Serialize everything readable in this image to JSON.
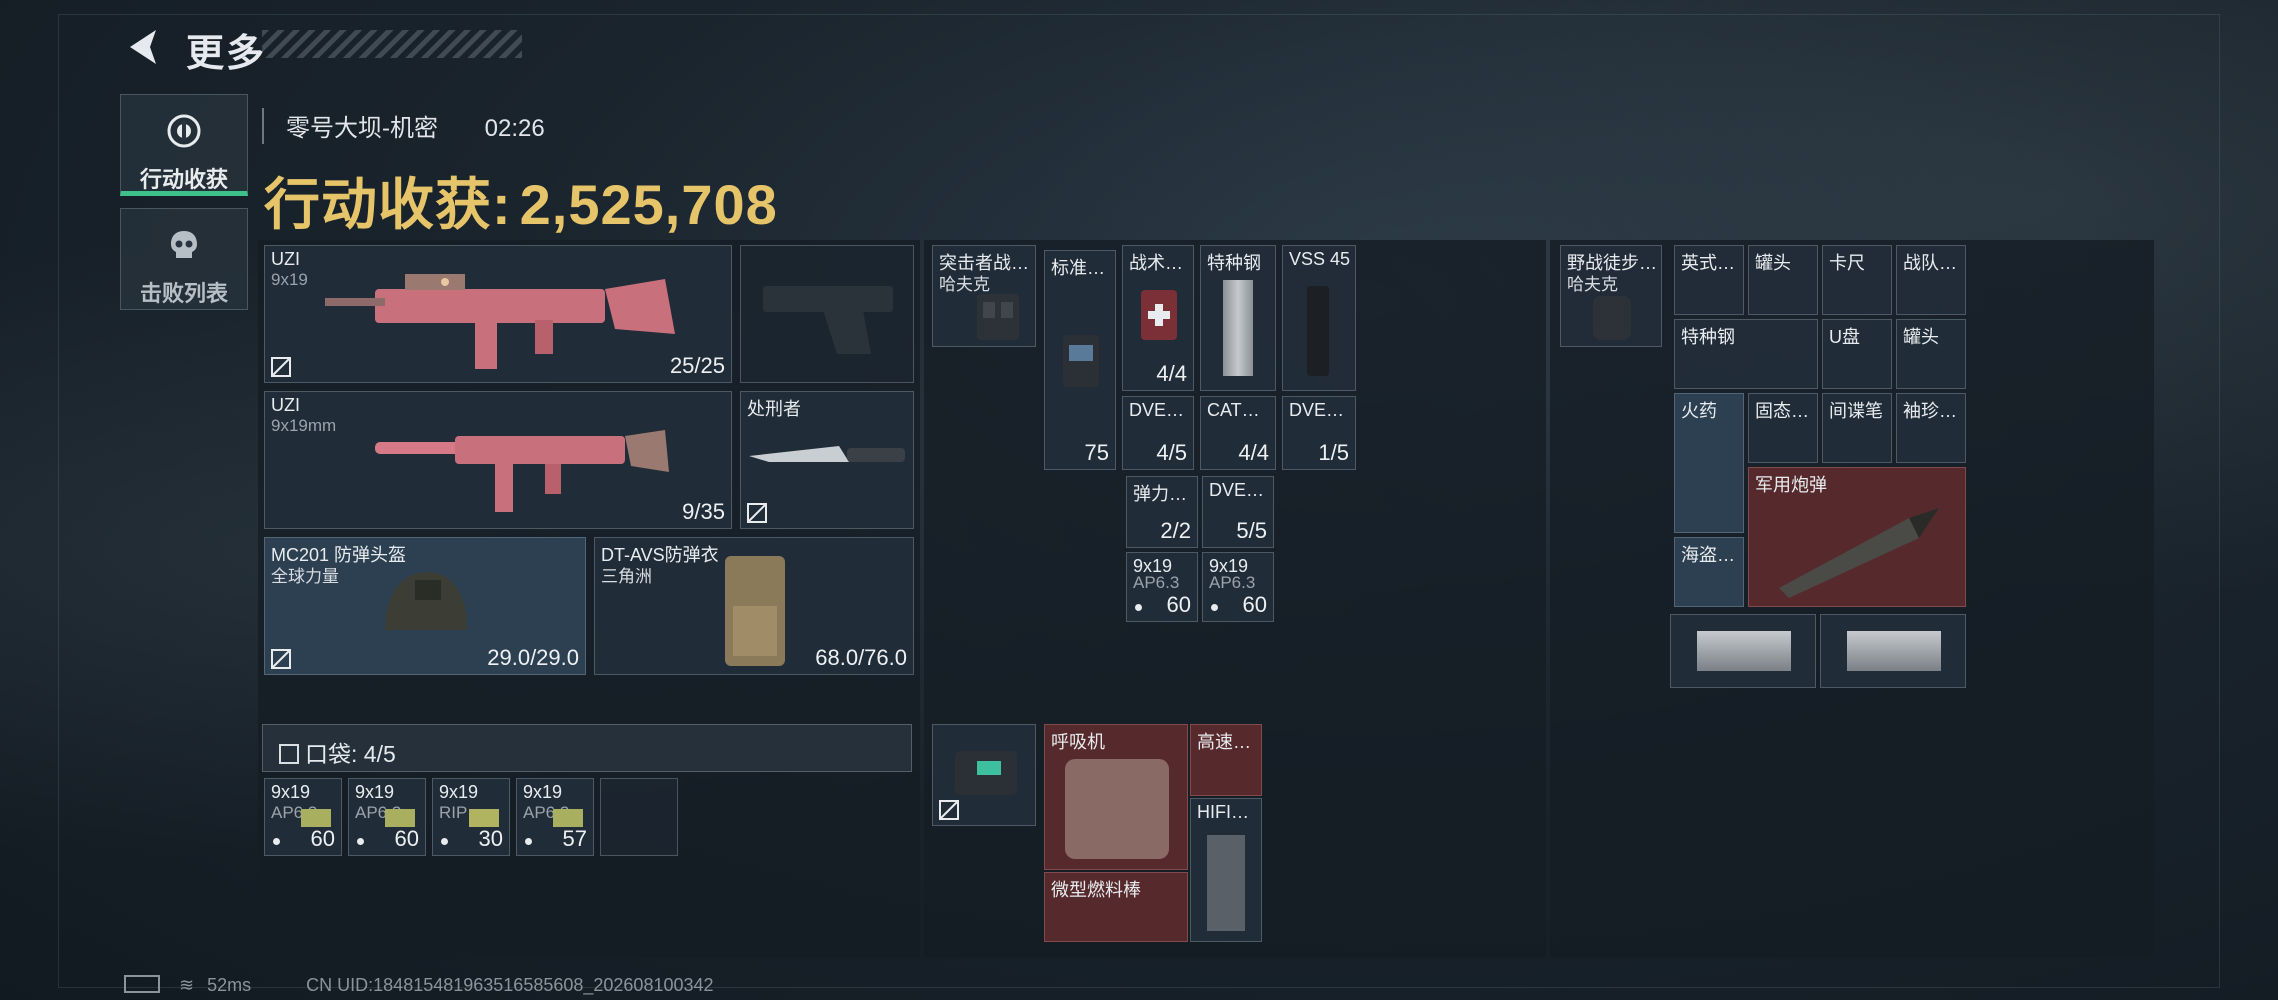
{
  "header": {
    "title": "更多"
  },
  "tabs": [
    {
      "label": "行动收获",
      "icon": "target-icon",
      "active": true
    },
    {
      "label": "击败列表",
      "icon": "skull-icon",
      "active": false
    }
  ],
  "map": {
    "name": "零号大坝-机密",
    "time": "02:26"
  },
  "gains": {
    "label": "行动收获:",
    "value": "2,525,708"
  },
  "weapons": [
    {
      "name": "UZI",
      "sub": "9x19",
      "count": "25/25"
    },
    {
      "name": "",
      "sub": "",
      "count": ""
    },
    {
      "name": "UZI",
      "sub": "9x19mm",
      "count": "9/35"
    },
    {
      "name": "处刑者",
      "sub": "",
      "count": ""
    }
  ],
  "armor": [
    {
      "name": "MC201 防弹头盔",
      "sub": "全球力量",
      "count": "29.0/29.0"
    },
    {
      "name": "DT-AVS防弹衣",
      "sub": "三角洲",
      "count": "68.0/76.0"
    }
  ],
  "pocket": {
    "label": "口袋:",
    "count": "4/5"
  },
  "pocket_items": [
    {
      "name": "9x19",
      "sub": "AP6.3",
      "count": "60"
    },
    {
      "name": "9x19",
      "sub": "AP6.3",
      "count": "60"
    },
    {
      "name": "9x19",
      "sub": "RIP",
      "count": "30"
    },
    {
      "name": "9x19",
      "sub": "AP6.3",
      "count": "57"
    }
  ],
  "rig": {
    "name": "突击者战…",
    "sub": "哈夫克"
  },
  "rig_items": [
    {
      "name": "标准…",
      "count": "75"
    },
    {
      "name": "战术…",
      "count": "4/4"
    },
    {
      "name": "特种钢",
      "count": ""
    },
    {
      "name": "VSS 45",
      "count": ""
    },
    {
      "name": "DVE…",
      "count": "4/5"
    },
    {
      "name": "CAT…",
      "count": "4/4"
    },
    {
      "name": "DVE…",
      "count": "1/5"
    },
    {
      "name": "弹力…",
      "count": "2/2"
    },
    {
      "name": "DVE…",
      "count": "5/5"
    },
    {
      "name": "9x19",
      "sub": "AP6.3",
      "count": "60"
    },
    {
      "name": "9x19",
      "sub": "AP6.3",
      "count": "60"
    }
  ],
  "safebox": {
    "count": ""
  },
  "safebox_items": [
    {
      "name": "呼吸机"
    },
    {
      "name": "高速…"
    },
    {
      "name": "HIFI…"
    },
    {
      "name": "微型燃料棒"
    }
  ],
  "backpack": {
    "name": "野战徒步…",
    "sub": "哈夫克"
  },
  "backpack_items": [
    {
      "name": "英式…"
    },
    {
      "name": "罐头"
    },
    {
      "name": "卡尺"
    },
    {
      "name": "战队…"
    },
    {
      "name": "特种钢"
    },
    {
      "name": "U盘"
    },
    {
      "name": "罐头"
    },
    {
      "name": "火药"
    },
    {
      "name": "固态…"
    },
    {
      "name": "间谍笔"
    },
    {
      "name": "袖珍…"
    },
    {
      "name": "军用炮弹"
    },
    {
      "name": "海盗…"
    },
    {
      "name": ""
    },
    {
      "name": ""
    }
  ],
  "footer": {
    "ping": "52ms",
    "uid": "CN UID:18481548196351658560​8_202608100342"
  },
  "colors": {
    "gain": "#e6c46a",
    "active_tab": "#3ec08a",
    "red_cell": "#5c2a2e",
    "blue_cell": "#2e4254"
  }
}
